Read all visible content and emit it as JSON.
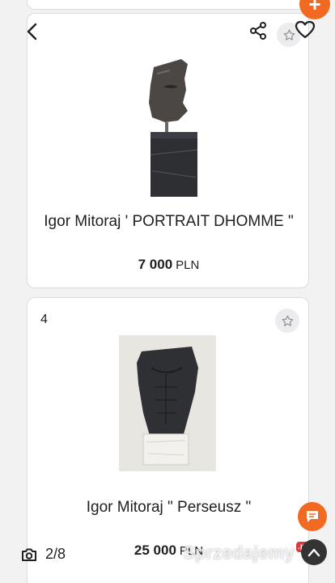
{
  "lots": [
    {
      "number": "",
      "title": "Igor Mitoraj ' PORTRAIT DHOMME \"",
      "price": "7 000",
      "currency": "PLN"
    },
    {
      "number": "4",
      "title": "Igor Mitoraj \" Perseusz \"",
      "price": "25 000",
      "currency": "PLN"
    }
  ],
  "gallery": {
    "counter": "2/8"
  },
  "watermark": {
    "text": "Sprzedajemy",
    "tld": ".pl"
  },
  "topbar": {
    "plus_label": "+"
  },
  "icons": {
    "back": "chevron-left-icon",
    "share": "share-icon",
    "favorite": "heart-icon",
    "star": "star-icon",
    "camera": "camera-icon",
    "chat": "chat-icon",
    "scroll_top": "chevron-up-icon"
  },
  "colors": {
    "accent": "#f26a21",
    "background": "#f2f2f3",
    "card": "#ffffff"
  }
}
